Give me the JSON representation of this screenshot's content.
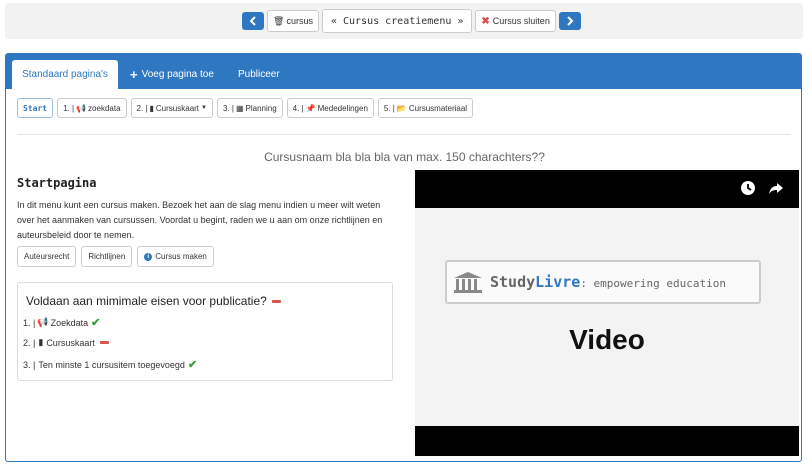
{
  "toolbar": {
    "cursus_label": "cursus",
    "title": "« Cursus creatiemenu »",
    "close_label": "Cursus sluiten"
  },
  "nav": {
    "tabs": [
      {
        "label": "Standaard pagina's",
        "active": true
      },
      {
        "label": "Voeg pagina toe",
        "active": false
      },
      {
        "label": "Publiceer",
        "active": false
      }
    ]
  },
  "steps": [
    {
      "label": "Start",
      "icon": ""
    },
    {
      "num": "1. |",
      "icon": "bullhorn-icon",
      "label": "zoekdata"
    },
    {
      "num": "2. |",
      "icon": "file-icon",
      "label": "Cursuskaart"
    },
    {
      "num": "3. |",
      "icon": "calendar-icon",
      "label": "Planning"
    },
    {
      "num": "4. |",
      "icon": "pin-icon",
      "label": "Mededelingen"
    },
    {
      "num": "5. |",
      "icon": "folder-icon",
      "label": "Cursusmateriaal"
    }
  ],
  "course_title": "Cursusnaam bla bla bla van max. 150 charachters??",
  "startpage": {
    "heading": "Startpagina",
    "intro": "In dit menu kunt een cursus maken. Bezoek het aan de slag menu indien u meer wilt weten over het aanmaken van cursussen. Voordat u begint, raden we u aan om onze richtlijnen en auteursbeleid door te nemen.",
    "buttons": {
      "copyright": "Auteursrecht",
      "guidelines": "Richtlijnen",
      "make_course": "Cursus maken"
    }
  },
  "requirements": {
    "title": "Voldaan aan mimimale eisen voor publicatie?",
    "items": [
      {
        "prefix": "1. |",
        "label": "Zoekdata",
        "status": "ok"
      },
      {
        "prefix": "2. |",
        "label": "Cursuskaart",
        "status": "missing"
      },
      {
        "prefix": "3. |",
        "label": "Ten minste 1 cursusitem toegevoegd",
        "status": "ok"
      }
    ]
  },
  "video": {
    "brand_study": "Study",
    "brand_livre": "Livre",
    "brand_tagline": ": empowering education",
    "label": "Video"
  },
  "colors": {
    "primary": "#2f77c0",
    "danger": "#d9534f",
    "success": "#3c9b3c"
  }
}
